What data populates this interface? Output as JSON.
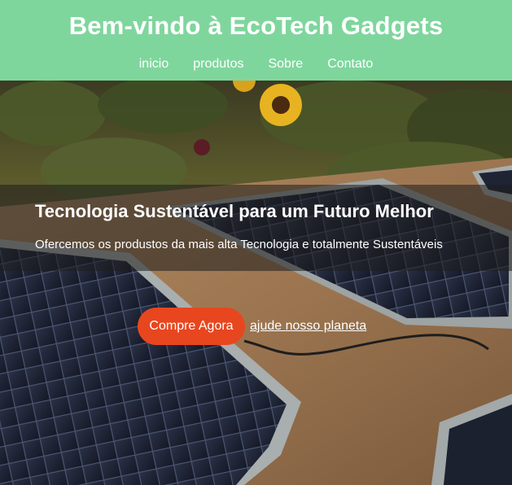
{
  "header": {
    "title": "Bem-vindo à EcoTech Gadgets",
    "nav": [
      {
        "label": "inicio"
      },
      {
        "label": "produtos"
      },
      {
        "label": "Sobre"
      },
      {
        "label": "Contato"
      }
    ]
  },
  "hero": {
    "title": "Tecnologia Sustentável para um Futuro Melhor",
    "subtitle": "Ofercemos os produstos da mais alta Tecnologia e totalmente Sustentáveis",
    "cta_label": "Compre Agora",
    "link_label": "ajude nosso planeta",
    "background_image": "solar-panels-in-garden"
  },
  "colors": {
    "header_bg": "#7fd69d",
    "cta_bg": "#e8461f",
    "text": "#ffffff"
  }
}
